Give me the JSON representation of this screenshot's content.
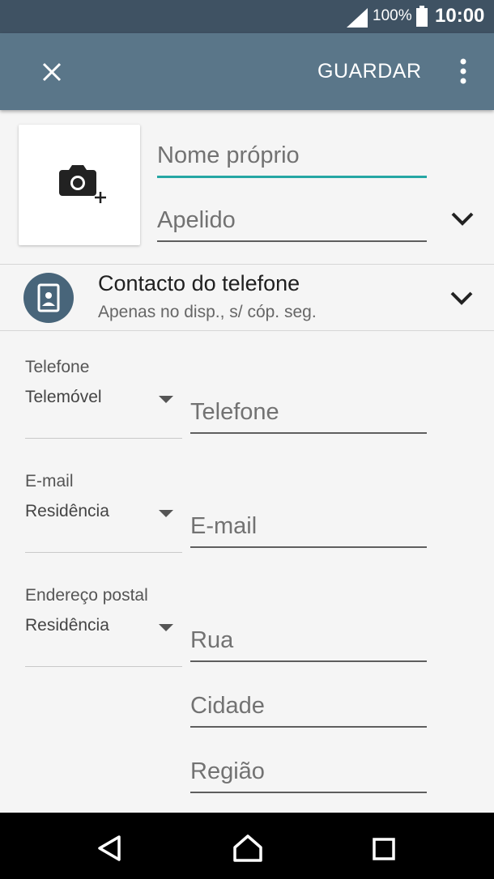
{
  "status": {
    "battery_pct": "100%",
    "time": "10:00"
  },
  "toolbar": {
    "save_label": "GUARDAR"
  },
  "name": {
    "first_placeholder": "Nome próprio",
    "last_placeholder": "Apelido"
  },
  "account": {
    "title": "Contacto do telefone",
    "subtitle": "Apenas no disp., s/ cóp. seg."
  },
  "phone": {
    "section": "Telefone",
    "type": "Telemóvel",
    "placeholder": "Telefone"
  },
  "email": {
    "section": "E-mail",
    "type": "Residência",
    "placeholder": "E-mail"
  },
  "address": {
    "section": "Endereço postal",
    "type": "Residência",
    "street": "Rua",
    "city": "Cidade",
    "region": "Região"
  },
  "colors": {
    "status_bar": "#3f5263",
    "toolbar": "#5a7689",
    "accent": "#26a7a4",
    "avatar": "#48657a"
  }
}
